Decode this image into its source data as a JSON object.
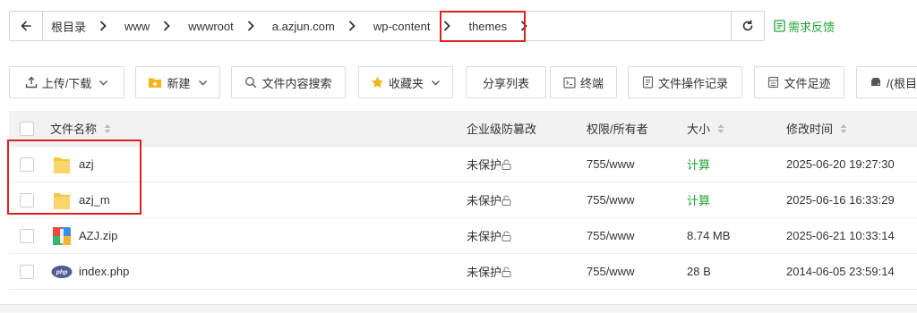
{
  "breadcrumb": {
    "items": [
      "根目录",
      "www",
      "wwwroot",
      "a.azjun.com",
      "wp-content",
      "themes"
    ]
  },
  "feedback_label": "需求反馈",
  "toolbar": {
    "upload": "上传/下载",
    "new": "新建",
    "search": "文件内容搜索",
    "favorites": "收藏夹",
    "share": "分享列表",
    "terminal": "终端",
    "oplog": "文件操作记录",
    "footprint": "文件足迹",
    "root": "/(根目"
  },
  "table": {
    "headers": {
      "name": "文件名称",
      "protect": "企业级防篡改",
      "perm": "权限/所有者",
      "size": "大小",
      "mtime": "修改时间"
    },
    "rows": [
      {
        "name": "azj",
        "protect": "未保护",
        "perm": "755/www",
        "size": "计算",
        "mtime": "2025-06-20 19:27:30"
      },
      {
        "name": "azj_m",
        "protect": "未保护",
        "perm": "755/www",
        "size": "计算",
        "mtime": "2025-06-16 16:33:29"
      },
      {
        "name": "AZJ.zip",
        "protect": "未保护",
        "perm": "755/www",
        "size": "8.74 MB",
        "mtime": "2025-06-21 10:33:14"
      },
      {
        "name": "index.php",
        "protect": "未保护",
        "perm": "755/www",
        "size": "28 B",
        "mtime": "2014-06-05 23:59:14"
      }
    ]
  },
  "colors": {
    "accent_green": "#20a53a",
    "highlight_red": "#e02020",
    "folder_yellow": "#f6c544"
  },
  "icons": {
    "back": "arrow-left-icon",
    "separator": "chevron-right-icon",
    "refresh": "refresh-icon",
    "feedback": "feedback-icon",
    "folder": "folder-icon",
    "zip": "zip-file-icon",
    "php": "php-file-icon",
    "lock": "lock-icon"
  }
}
